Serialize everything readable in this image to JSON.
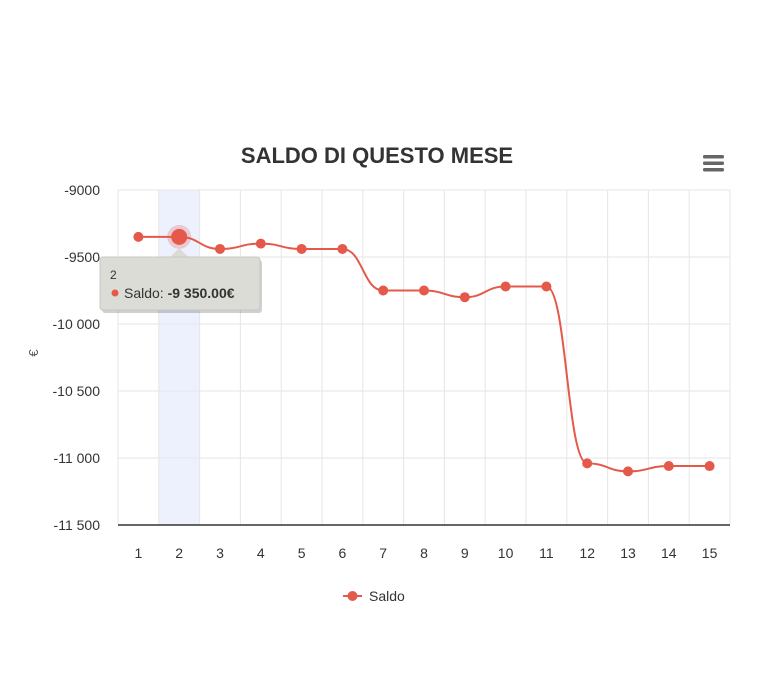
{
  "chart_data": {
    "type": "line",
    "title": "SALDO DI QUESTO MESE",
    "ylabel": "€",
    "xlabel": "",
    "categories": [
      "1",
      "2",
      "3",
      "4",
      "5",
      "6",
      "7",
      "8",
      "9",
      "10",
      "11",
      "12",
      "13",
      "14",
      "15"
    ],
    "series": [
      {
        "name": "Saldo",
        "color": "#e4594a",
        "values": [
          -9350,
          -9350,
          -9440,
          -9400,
          -9440,
          -9440,
          -9750,
          -9750,
          -9800,
          -9720,
          -9720,
          -11040,
          -11100,
          -11060,
          -11060
        ]
      }
    ],
    "ylim": [
      -11500,
      -9000
    ],
    "yticks": [
      {
        "value": -9000,
        "label": "-9000"
      },
      {
        "value": -9500,
        "label": "-9500"
      },
      {
        "value": -10000,
        "label": "-10 000"
      },
      {
        "value": -10500,
        "label": "-10 500"
      },
      {
        "value": -11000,
        "label": "-11 000"
      },
      {
        "value": -11500,
        "label": "-11 500"
      }
    ],
    "grid": true,
    "legend": "bottom-center",
    "highlight_index": 1,
    "tooltip": {
      "header": "2",
      "label": "Saldo: ",
      "value": "-9 350.00€"
    }
  },
  "colors": {
    "series": "#e4594a",
    "highlight_band": "#e6ebfd",
    "grid": "#e6e6e6",
    "axis": "#333333"
  },
  "menu": {
    "icon": "hamburger-menu-icon"
  }
}
